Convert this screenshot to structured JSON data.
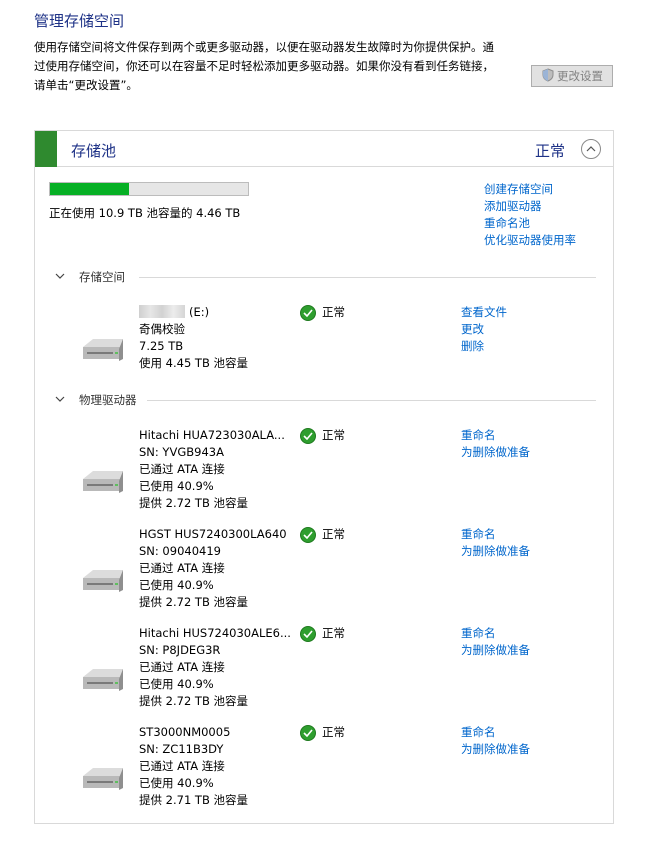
{
  "page": {
    "title": "管理存储空间",
    "description_line1": "使用存储空间将文件保存到两个或更多驱动器，以便在驱动器发生故障时为你提供保护。通",
    "description_line2": "过使用存储空间，你还可以在容量不足时轻松添加更多驱动器。如果你没有看到任务链接，",
    "description_line3": "请单击“更改设置”。",
    "change_settings_label": "更改设置"
  },
  "pool": {
    "title": "存储池",
    "status": "正常",
    "usage_fraction": 0.4,
    "usage_text": "正在使用 10.9 TB 池容量的 4.46 TB",
    "links": [
      "创建存储空间",
      "添加驱动器",
      "重命名池",
      "优化驱动器使用率"
    ]
  },
  "spaces_section": {
    "label": "存储空间",
    "items": [
      {
        "drive": "(E:)",
        "resiliency": "奇偶校验",
        "size": "7.25 TB",
        "used": "使用 4.45 TB 池容量",
        "status": "正常",
        "links": [
          "查看文件",
          "更改",
          "删除"
        ]
      }
    ]
  },
  "drives_section": {
    "label": "物理驱动器",
    "items": [
      {
        "name": "Hitachi HUA723030ALA...",
        "sn": "SN: YVGB943A",
        "conn": "已通过 ATA 连接",
        "used": "已使用 40.9%",
        "provides": "提供 2.72 TB 池容量",
        "status": "正常",
        "links": [
          "重命名",
          "为删除做准备"
        ]
      },
      {
        "name": "HGST HUS7240300LA640",
        "sn": "SN: 09040419",
        "conn": "已通过 ATA 连接",
        "used": "已使用 40.9%",
        "provides": "提供 2.72 TB 池容量",
        "status": "正常",
        "links": [
          "重命名",
          "为删除做准备"
        ]
      },
      {
        "name": "Hitachi HUS724030ALE6...",
        "sn": "SN: P8JDEG3R",
        "conn": "已通过 ATA 连接",
        "used": "已使用 40.9%",
        "provides": "提供 2.72 TB 池容量",
        "status": "正常",
        "links": [
          "重命名",
          "为删除做准备"
        ]
      },
      {
        "name": "ST3000NM0005",
        "sn": "SN: ZC11B3DY",
        "conn": "已通过 ATA 连接",
        "used": "已使用 40.9%",
        "provides": "提供 2.71 TB 池容量",
        "status": "正常",
        "links": [
          "重命名",
          "为删除做准备"
        ]
      }
    ]
  },
  "colors": {
    "title": "#1e3287",
    "link": "#0066cc",
    "progress": "#06b025",
    "accent_bar": "#2f8a2f"
  }
}
